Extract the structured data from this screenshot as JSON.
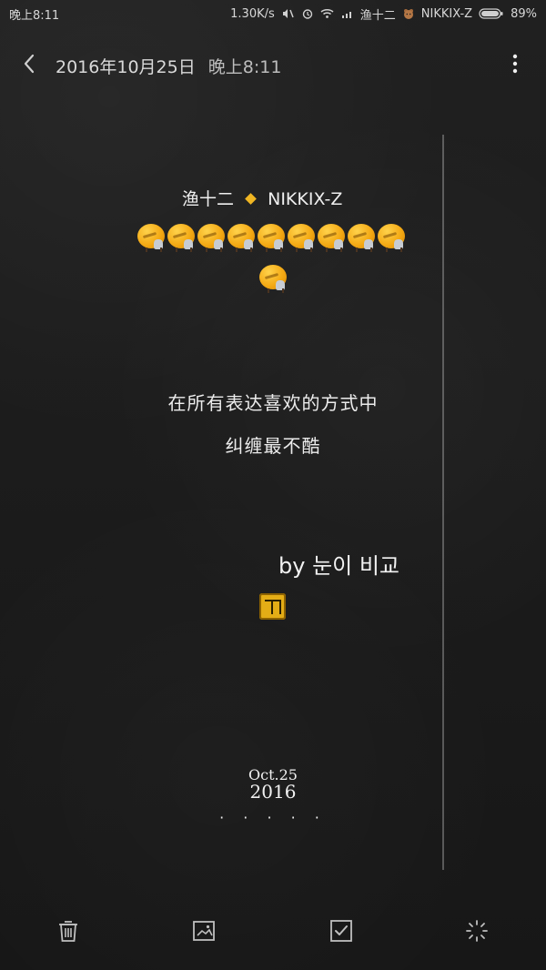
{
  "status_bar": {
    "left_time": "晚上8:11",
    "network_speed": "1.30K/s",
    "right_user": "渔十二",
    "right_name": "NIKKIX-Z",
    "battery": "89%"
  },
  "header": {
    "date": "2016年10月25日",
    "time": "晚上8:11"
  },
  "note": {
    "author_prefix": "渔十二",
    "author_suffix": "NIKKIX-Z",
    "quote_line_1": "在所有表达喜欢的方式中",
    "quote_line_2": "纠缠最不酷",
    "signature": "by 눈이 비교",
    "date_line_1": "Oct.25",
    "date_line_2": "2016",
    "dots": "· · · · ·"
  },
  "icons": {
    "back": "chevron-left-icon",
    "more": "more-vertical-icon",
    "delete": "trash-icon",
    "image": "image-icon",
    "check": "checkbox-icon",
    "magic": "sparkle-icon"
  },
  "colors": {
    "accent": "#f0b623",
    "text": "#e8e8e8",
    "background": "#1b1b1b"
  }
}
